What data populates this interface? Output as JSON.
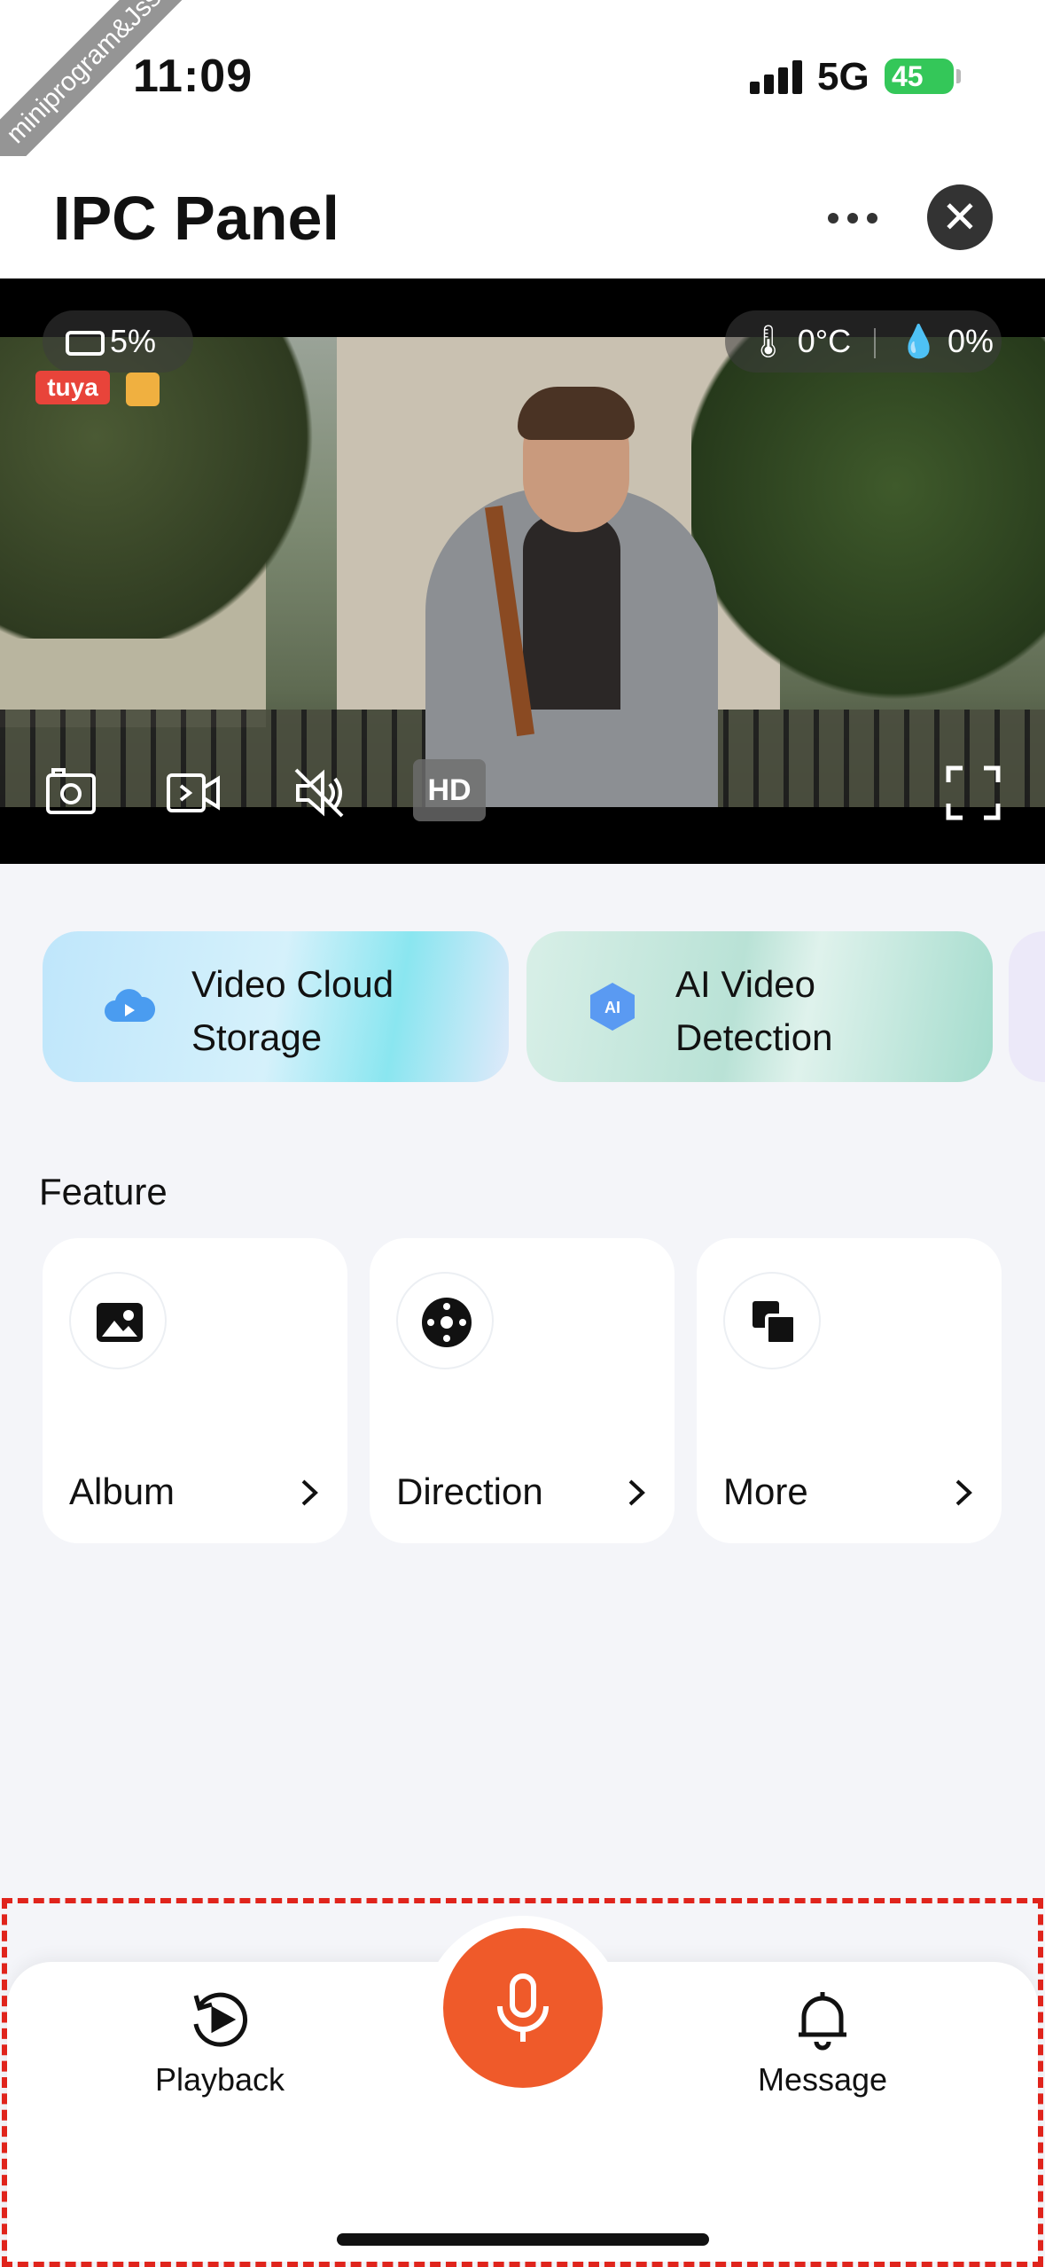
{
  "status_bar": {
    "watermark": "miniprogram&Jss",
    "time": "11:09",
    "network": "5G",
    "battery": "45"
  },
  "header": {
    "title": "IPC Panel",
    "more_icon": "more-dots-icon",
    "close_icon": "close-icon"
  },
  "video": {
    "battery_level": "5%",
    "temperature": "0°C",
    "humidity": "0%",
    "brand_logo": "tuya",
    "quality_label": "HD",
    "controls": [
      "screenshot-icon",
      "record-icon",
      "mute-icon",
      "hd-toggle",
      "fullscreen-icon"
    ]
  },
  "services": [
    {
      "line1": "Video Cloud",
      "line2": "Storage",
      "icon": "cloud-icon",
      "accent": "#4a9cf0"
    },
    {
      "line1": "AI Video",
      "line2": "Detection",
      "icon": "ai-icon",
      "accent": "#4a86f0"
    }
  ],
  "feature": {
    "title": "Feature",
    "items": [
      {
        "label": "Album",
        "icon": "image-icon"
      },
      {
        "label": "Direction",
        "icon": "direction-pad-icon"
      },
      {
        "label": "More",
        "icon": "copy-icon"
      }
    ]
  },
  "bottom_nav": {
    "playback": "Playback",
    "message": "Message",
    "mic_color": "#ef5a2a",
    "highlight_color": "#e0241c"
  }
}
